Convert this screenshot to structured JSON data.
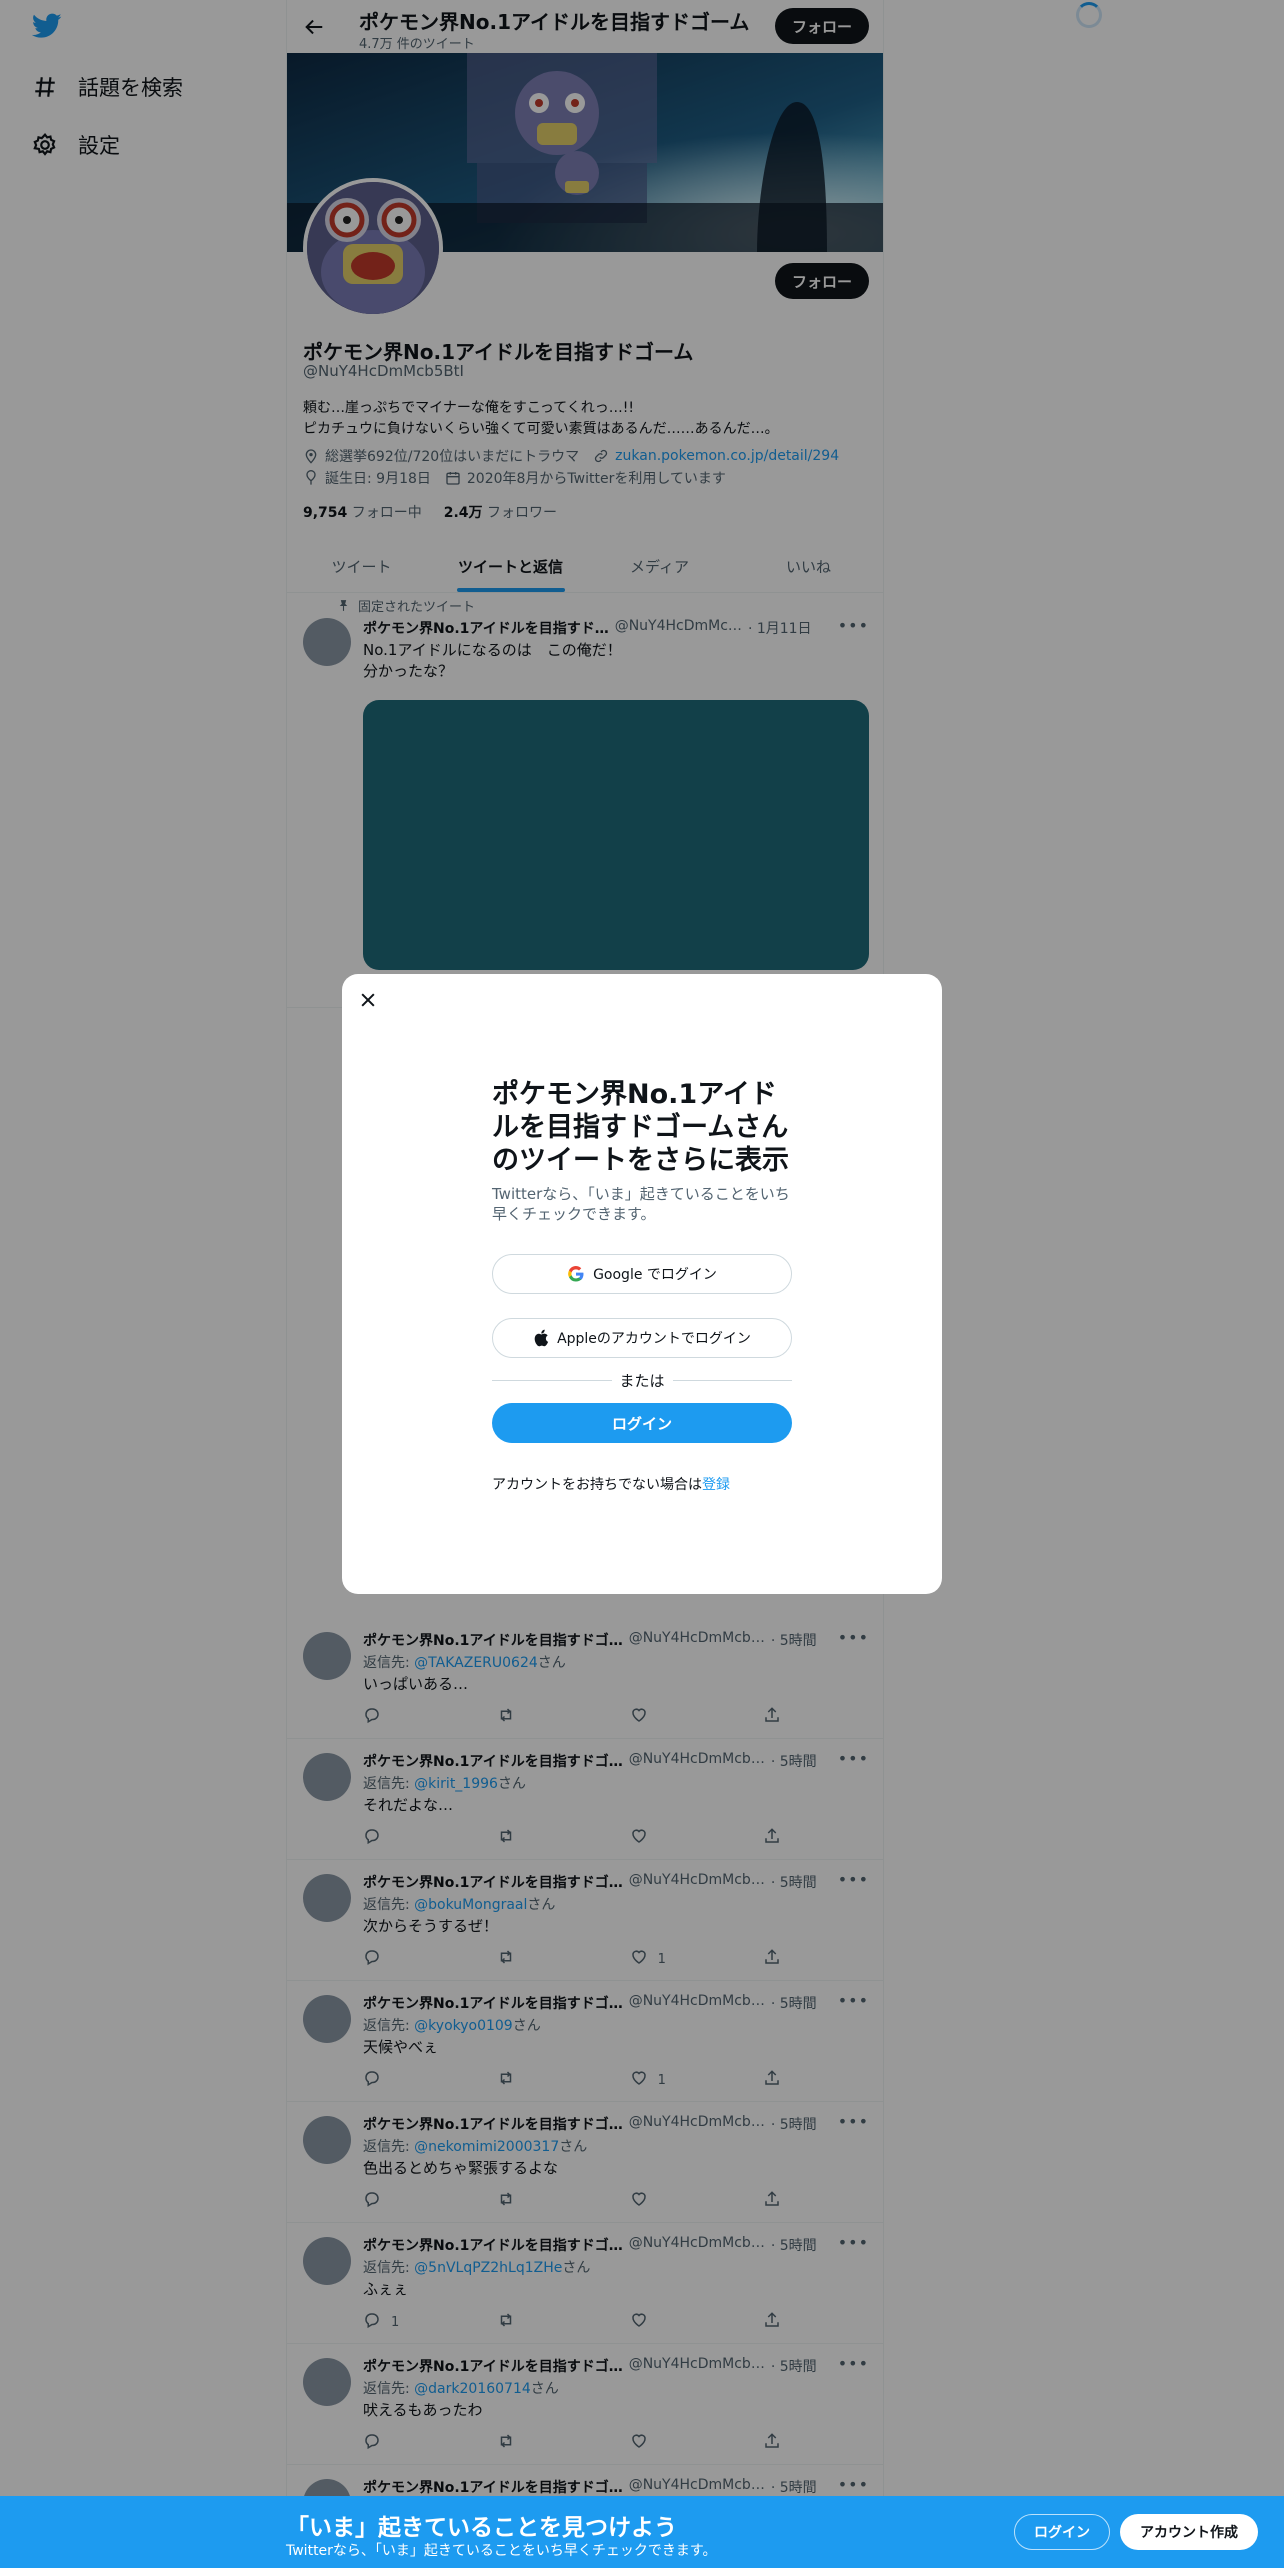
{
  "nav": {
    "search_label": "話題を検索",
    "settings_label": "設定"
  },
  "header": {
    "name": "ポケモン界No.1アイドルを目指すドゴーム",
    "tweet_count": "4.7万 件のツイート",
    "follow_label": "フォロー"
  },
  "profile": {
    "name": "ポケモン界No.1アイドルを目指すドゴーム",
    "handle": "@NuY4HcDmMcb5BtI",
    "bio_line1": "頼む…崖っぷちでマイナーな俺をすこってくれっ…!!",
    "bio_line2": "ピカチュウに負けないくらい強くて可愛い素質はあるんだ……あるんだ…。",
    "location": "総選挙692位/720位はいまだにトラウマ",
    "url": "zukan.pokemon.co.jp/detail/294",
    "birthday": "誕生日: 9月18日",
    "joined": "2020年8月からTwitterを利用しています",
    "following_count": "9,754",
    "following_label": "フォロー中",
    "followers_count": "2.4万",
    "followers_label": "フォロワー",
    "follow_label": "フォロー"
  },
  "tabs": [
    "ツイート",
    "ツイートと返信",
    "メディア",
    "いいね"
  ],
  "pinned": {
    "label": "固定されたツイート",
    "name": "ポケモン界No.1アイドルを目指すド…",
    "handle": "@NuY4HcDmMc…",
    "time": "· 1月11日",
    "line1": "No.1アイドルになるのは　この俺だ！",
    "line2": "分かったな？"
  },
  "tweets": [
    {
      "name": "ポケモン界No.1アイドルを目指すドゴ…",
      "handle": "@NuY4HcDmMcb…",
      "time": "· 5時間",
      "reply_prefix": "返信先: ",
      "reply_to": "@TAKAZERU0624",
      "reply_suffix": "さん",
      "text": "いっぱいある…",
      "reply_count": "",
      "like_count": ""
    },
    {
      "name": "ポケモン界No.1アイドルを目指すドゴ…",
      "handle": "@NuY4HcDmMcb…",
      "time": "· 5時間",
      "reply_prefix": "返信先: ",
      "reply_to": "@kirit_1996",
      "reply_suffix": "さん",
      "text": "それだよな…",
      "reply_count": "",
      "like_count": ""
    },
    {
      "name": "ポケモン界No.1アイドルを目指すドゴ…",
      "handle": "@NuY4HcDmMcb…",
      "time": "· 5時間",
      "reply_prefix": "返信先: ",
      "reply_to": "@bokuMongraal",
      "reply_suffix": "さん",
      "text": "次からそうするぜ！",
      "reply_count": "",
      "like_count": "1"
    },
    {
      "name": "ポケモン界No.1アイドルを目指すドゴ…",
      "handle": "@NuY4HcDmMcb…",
      "time": "· 5時間",
      "reply_prefix": "返信先: ",
      "reply_to": "@kyokyo0109",
      "reply_suffix": "さん",
      "text": "天候やべぇ",
      "reply_count": "",
      "like_count": "1"
    },
    {
      "name": "ポケモン界No.1アイドルを目指すドゴ…",
      "handle": "@NuY4HcDmMcb…",
      "time": "· 5時間",
      "reply_prefix": "返信先: ",
      "reply_to": "@nekomimi2000317",
      "reply_suffix": "さん",
      "text": "色出るとめちゃ緊張するよな",
      "reply_count": "",
      "like_count": ""
    },
    {
      "name": "ポケモン界No.1アイドルを目指すドゴ…",
      "handle": "@NuY4HcDmMcb…",
      "time": "· 5時間",
      "reply_prefix": "返信先: ",
      "reply_to": "@5nVLqPZ2hLq1ZHe",
      "reply_suffix": "さん",
      "text": "ふぇぇ",
      "reply_count": "1",
      "like_count": ""
    },
    {
      "name": "ポケモン界No.1アイドルを目指すドゴ…",
      "handle": "@NuY4HcDmMcb…",
      "time": "· 5時間",
      "reply_prefix": "返信先: ",
      "reply_to": "@dark20160714",
      "reply_suffix": "さん",
      "text": "吠えるもあったわ",
      "reply_count": "",
      "like_count": ""
    },
    {
      "name": "ポケモン界No.1アイドルを目指すドゴ…",
      "handle": "@NuY4HcDmMcb…",
      "time": "· 5時間",
      "reply_prefix": "",
      "reply_to": "",
      "reply_suffix": "",
      "text": "",
      "reply_count": "",
      "like_count": ""
    }
  ],
  "modal": {
    "title": "ポケモン界No.1アイドルを目指すドゴームさんのツイートをさらに表示",
    "subtitle": "Twitterなら、「いま」起きていることをいち早くチェックできます。",
    "google_label": "Google でログイン",
    "apple_label": "Appleのアカウントでログイン",
    "or_label": "または",
    "login_label": "ログイン",
    "signup_prompt": "アカウントをお持ちでない場合は",
    "signup_link": "登録"
  },
  "bottom_bar": {
    "title": "「いま」起きていることを見つけよう",
    "subtitle": "Twitterなら、「いま」起きていることをいち早くチェックできます。",
    "login_label": "ログイン",
    "signup_label": "アカウント作成"
  },
  "colors": {
    "accent": "#1d9bf0",
    "text": "#0f1419",
    "muted": "#536471",
    "media": "#1e6b7b"
  }
}
